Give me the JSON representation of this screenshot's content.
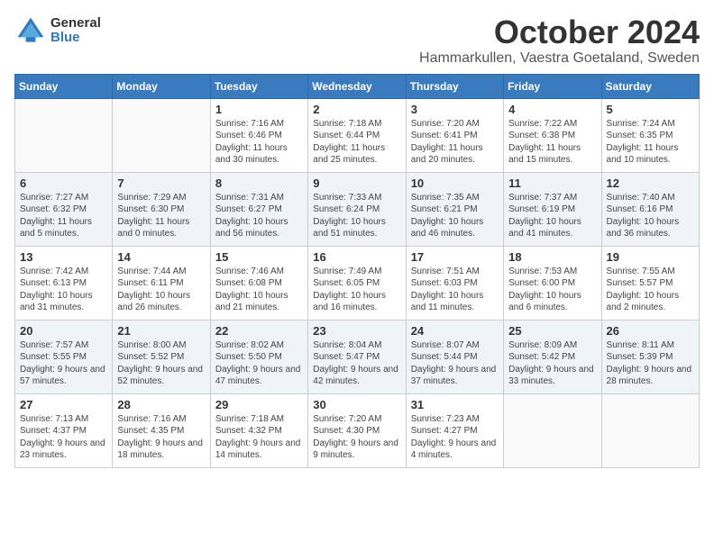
{
  "logo": {
    "general": "General",
    "blue": "Blue"
  },
  "title": "October 2024",
  "location": "Hammarkullen, Vaestra Goetaland, Sweden",
  "days": [
    "Sunday",
    "Monday",
    "Tuesday",
    "Wednesday",
    "Thursday",
    "Friday",
    "Saturday"
  ],
  "weeks": [
    [
      {
        "num": "",
        "sunrise": "",
        "sunset": "",
        "daylight": ""
      },
      {
        "num": "",
        "sunrise": "",
        "sunset": "",
        "daylight": ""
      },
      {
        "num": "1",
        "sunrise": "Sunrise: 7:16 AM",
        "sunset": "Sunset: 6:46 PM",
        "daylight": "Daylight: 11 hours and 30 minutes."
      },
      {
        "num": "2",
        "sunrise": "Sunrise: 7:18 AM",
        "sunset": "Sunset: 6:44 PM",
        "daylight": "Daylight: 11 hours and 25 minutes."
      },
      {
        "num": "3",
        "sunrise": "Sunrise: 7:20 AM",
        "sunset": "Sunset: 6:41 PM",
        "daylight": "Daylight: 11 hours and 20 minutes."
      },
      {
        "num": "4",
        "sunrise": "Sunrise: 7:22 AM",
        "sunset": "Sunset: 6:38 PM",
        "daylight": "Daylight: 11 hours and 15 minutes."
      },
      {
        "num": "5",
        "sunrise": "Sunrise: 7:24 AM",
        "sunset": "Sunset: 6:35 PM",
        "daylight": "Daylight: 11 hours and 10 minutes."
      }
    ],
    [
      {
        "num": "6",
        "sunrise": "Sunrise: 7:27 AM",
        "sunset": "Sunset: 6:32 PM",
        "daylight": "Daylight: 11 hours and 5 minutes."
      },
      {
        "num": "7",
        "sunrise": "Sunrise: 7:29 AM",
        "sunset": "Sunset: 6:30 PM",
        "daylight": "Daylight: 11 hours and 0 minutes."
      },
      {
        "num": "8",
        "sunrise": "Sunrise: 7:31 AM",
        "sunset": "Sunset: 6:27 PM",
        "daylight": "Daylight: 10 hours and 56 minutes."
      },
      {
        "num": "9",
        "sunrise": "Sunrise: 7:33 AM",
        "sunset": "Sunset: 6:24 PM",
        "daylight": "Daylight: 10 hours and 51 minutes."
      },
      {
        "num": "10",
        "sunrise": "Sunrise: 7:35 AM",
        "sunset": "Sunset: 6:21 PM",
        "daylight": "Daylight: 10 hours and 46 minutes."
      },
      {
        "num": "11",
        "sunrise": "Sunrise: 7:37 AM",
        "sunset": "Sunset: 6:19 PM",
        "daylight": "Daylight: 10 hours and 41 minutes."
      },
      {
        "num": "12",
        "sunrise": "Sunrise: 7:40 AM",
        "sunset": "Sunset: 6:16 PM",
        "daylight": "Daylight: 10 hours and 36 minutes."
      }
    ],
    [
      {
        "num": "13",
        "sunrise": "Sunrise: 7:42 AM",
        "sunset": "Sunset: 6:13 PM",
        "daylight": "Daylight: 10 hours and 31 minutes."
      },
      {
        "num": "14",
        "sunrise": "Sunrise: 7:44 AM",
        "sunset": "Sunset: 6:11 PM",
        "daylight": "Daylight: 10 hours and 26 minutes."
      },
      {
        "num": "15",
        "sunrise": "Sunrise: 7:46 AM",
        "sunset": "Sunset: 6:08 PM",
        "daylight": "Daylight: 10 hours and 21 minutes."
      },
      {
        "num": "16",
        "sunrise": "Sunrise: 7:49 AM",
        "sunset": "Sunset: 6:05 PM",
        "daylight": "Daylight: 10 hours and 16 minutes."
      },
      {
        "num": "17",
        "sunrise": "Sunrise: 7:51 AM",
        "sunset": "Sunset: 6:03 PM",
        "daylight": "Daylight: 10 hours and 11 minutes."
      },
      {
        "num": "18",
        "sunrise": "Sunrise: 7:53 AM",
        "sunset": "Sunset: 6:00 PM",
        "daylight": "Daylight: 10 hours and 6 minutes."
      },
      {
        "num": "19",
        "sunrise": "Sunrise: 7:55 AM",
        "sunset": "Sunset: 5:57 PM",
        "daylight": "Daylight: 10 hours and 2 minutes."
      }
    ],
    [
      {
        "num": "20",
        "sunrise": "Sunrise: 7:57 AM",
        "sunset": "Sunset: 5:55 PM",
        "daylight": "Daylight: 9 hours and 57 minutes."
      },
      {
        "num": "21",
        "sunrise": "Sunrise: 8:00 AM",
        "sunset": "Sunset: 5:52 PM",
        "daylight": "Daylight: 9 hours and 52 minutes."
      },
      {
        "num": "22",
        "sunrise": "Sunrise: 8:02 AM",
        "sunset": "Sunset: 5:50 PM",
        "daylight": "Daylight: 9 hours and 47 minutes."
      },
      {
        "num": "23",
        "sunrise": "Sunrise: 8:04 AM",
        "sunset": "Sunset: 5:47 PM",
        "daylight": "Daylight: 9 hours and 42 minutes."
      },
      {
        "num": "24",
        "sunrise": "Sunrise: 8:07 AM",
        "sunset": "Sunset: 5:44 PM",
        "daylight": "Daylight: 9 hours and 37 minutes."
      },
      {
        "num": "25",
        "sunrise": "Sunrise: 8:09 AM",
        "sunset": "Sunset: 5:42 PM",
        "daylight": "Daylight: 9 hours and 33 minutes."
      },
      {
        "num": "26",
        "sunrise": "Sunrise: 8:11 AM",
        "sunset": "Sunset: 5:39 PM",
        "daylight": "Daylight: 9 hours and 28 minutes."
      }
    ],
    [
      {
        "num": "27",
        "sunrise": "Sunrise: 7:13 AM",
        "sunset": "Sunset: 4:37 PM",
        "daylight": "Daylight: 9 hours and 23 minutes."
      },
      {
        "num": "28",
        "sunrise": "Sunrise: 7:16 AM",
        "sunset": "Sunset: 4:35 PM",
        "daylight": "Daylight: 9 hours and 18 minutes."
      },
      {
        "num": "29",
        "sunrise": "Sunrise: 7:18 AM",
        "sunset": "Sunset: 4:32 PM",
        "daylight": "Daylight: 9 hours and 14 minutes."
      },
      {
        "num": "30",
        "sunrise": "Sunrise: 7:20 AM",
        "sunset": "Sunset: 4:30 PM",
        "daylight": "Daylight: 9 hours and 9 minutes."
      },
      {
        "num": "31",
        "sunrise": "Sunrise: 7:23 AM",
        "sunset": "Sunset: 4:27 PM",
        "daylight": "Daylight: 9 hours and 4 minutes."
      },
      {
        "num": "",
        "sunrise": "",
        "sunset": "",
        "daylight": ""
      },
      {
        "num": "",
        "sunrise": "",
        "sunset": "",
        "daylight": ""
      }
    ]
  ]
}
